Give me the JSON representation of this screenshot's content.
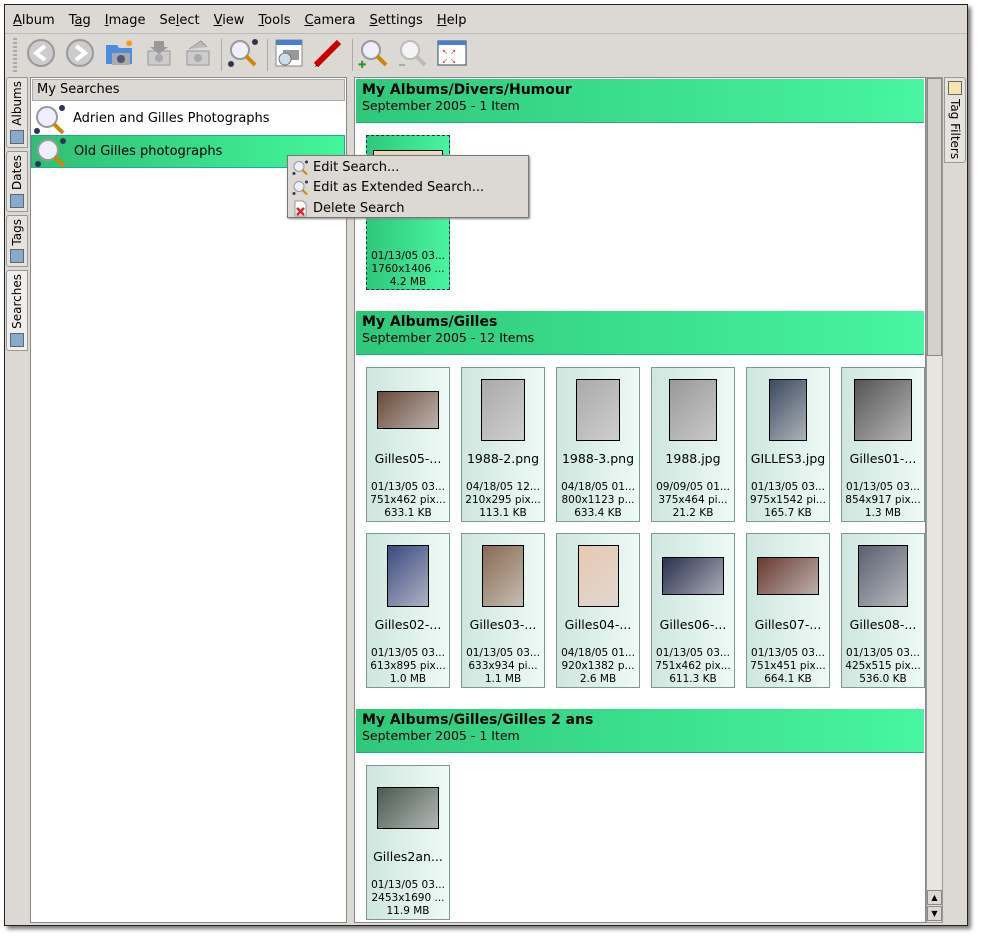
{
  "menubar": [
    {
      "label": "Album",
      "u": "A",
      "rest": "lbum"
    },
    {
      "label": "Tag",
      "pre": "T",
      "u": "a",
      "rest": "g"
    },
    {
      "label": "Image",
      "u": "I",
      "rest": "mage"
    },
    {
      "label": "Select",
      "pre": "Se",
      "u": "l",
      "rest": "ect"
    },
    {
      "label": "View",
      "u": "V",
      "rest": "iew"
    },
    {
      "label": "Tools",
      "u": "T",
      "rest": "ools"
    },
    {
      "label": "Camera",
      "u": "C",
      "rest": "amera"
    },
    {
      "label": "Settings",
      "u": "S",
      "rest": "ettings"
    },
    {
      "label": "Help",
      "u": "H",
      "rest": "elp"
    }
  ],
  "toolbar": [
    "back-icon",
    "forward-icon",
    "new-album-icon",
    "import-icon",
    "export-icon",
    "search-icon",
    "image-viewer-icon",
    "edit-pencil-icon",
    "zoom-in-icon",
    "zoom-out-icon",
    "fullscreen-icon"
  ],
  "left_tabs": [
    "Albums",
    "Dates",
    "Tags",
    "Searches"
  ],
  "right_tabs": [
    "Tag Filters"
  ],
  "left_panel": {
    "header": "My Searches",
    "items": [
      "Adrien and Gilles Photographs",
      "Old Gilles photographs"
    ]
  },
  "context_menu": [
    "Edit Search...",
    "Edit as Extended Search...",
    "Delete Search"
  ],
  "sections": [
    {
      "title": "My Albums/Divers/Humour",
      "subtitle": "September 2005 - 1 Item",
      "items": [
        {
          "name": "",
          "date": "01/13/05 03...",
          "dims": "1760x1406 ...",
          "size": "4.2 MB",
          "selected": true,
          "color": "#f2d9a8",
          "w": 70,
          "h": 20
        }
      ]
    },
    {
      "title": "My Albums/Gilles",
      "subtitle": "September 2005 - 12 Items",
      "items": [
        {
          "name": "Gilles05-...",
          "date": "01/13/05 03...",
          "dims": "751x462 pix...",
          "size": "633.1 KB",
          "color": "#6a4a3a",
          "w": 62,
          "h": 38
        },
        {
          "name": "1988-2.png",
          "date": "04/18/05 12...",
          "dims": "210x295 pix...",
          "size": "113.1 KB",
          "color": "#aaa",
          "w": 44,
          "h": 62
        },
        {
          "name": "1988-3.png",
          "date": "04/18/05 01...",
          "dims": "800x1123 p...",
          "size": "633.4 KB",
          "color": "#aaa",
          "w": 44,
          "h": 62
        },
        {
          "name": "1988.jpg",
          "date": "09/09/05 01...",
          "dims": "375x464 pi...",
          "size": "21.2 KB",
          "color": "#999",
          "w": 48,
          "h": 62
        },
        {
          "name": "GILLES3.jpg",
          "date": "01/13/05 03...",
          "dims": "975x1542 pi...",
          "size": "165.7 KB",
          "color": "#3a4a60",
          "w": 38,
          "h": 62
        },
        {
          "name": "Gilles01-...",
          "date": "01/13/05 03...",
          "dims": "854x917 pix...",
          "size": "1.3 MB",
          "color": "#555",
          "w": 58,
          "h": 62
        },
        {
          "name": "Gilles02-...",
          "date": "01/13/05 03...",
          "dims": "613x895 pix...",
          "size": "1.0 MB",
          "color": "#3a4a80",
          "w": 42,
          "h": 62
        },
        {
          "name": "Gilles03-...",
          "date": "01/13/05 03...",
          "dims": "633x934 pi...",
          "size": "1.1 MB",
          "color": "#8a6a50",
          "w": 42,
          "h": 62
        },
        {
          "name": "Gilles04-...",
          "date": "04/18/05 01...",
          "dims": "920x1382 p...",
          "size": "2.6 MB",
          "color": "#e8c8b0",
          "w": 41,
          "h": 62
        },
        {
          "name": "Gilles06-...",
          "date": "01/13/05 03...",
          "dims": "751x462 pix...",
          "size": "611.3 KB",
          "color": "#2a3050",
          "w": 62,
          "h": 38
        },
        {
          "name": "Gilles07-...",
          "date": "01/13/05 03...",
          "dims": "751x451 pix...",
          "size": "664.1 KB",
          "color": "#6a3a30",
          "w": 62,
          "h": 38
        },
        {
          "name": "Gilles08-...",
          "date": "01/13/05 03...",
          "dims": "425x515 pix...",
          "size": "536.0 KB",
          "color": "#5a6070",
          "w": 50,
          "h": 62
        }
      ]
    },
    {
      "title": "My Albums/Gilles/Gilles 2 ans",
      "subtitle": "September 2005 - 1 Item",
      "items": [
        {
          "name": "Gilles2an...",
          "date": "01/13/05 03...",
          "dims": "2453x1690 ...",
          "size": "11.9 MB",
          "color": "#4a5a50",
          "w": 62,
          "h": 42
        }
      ]
    }
  ]
}
